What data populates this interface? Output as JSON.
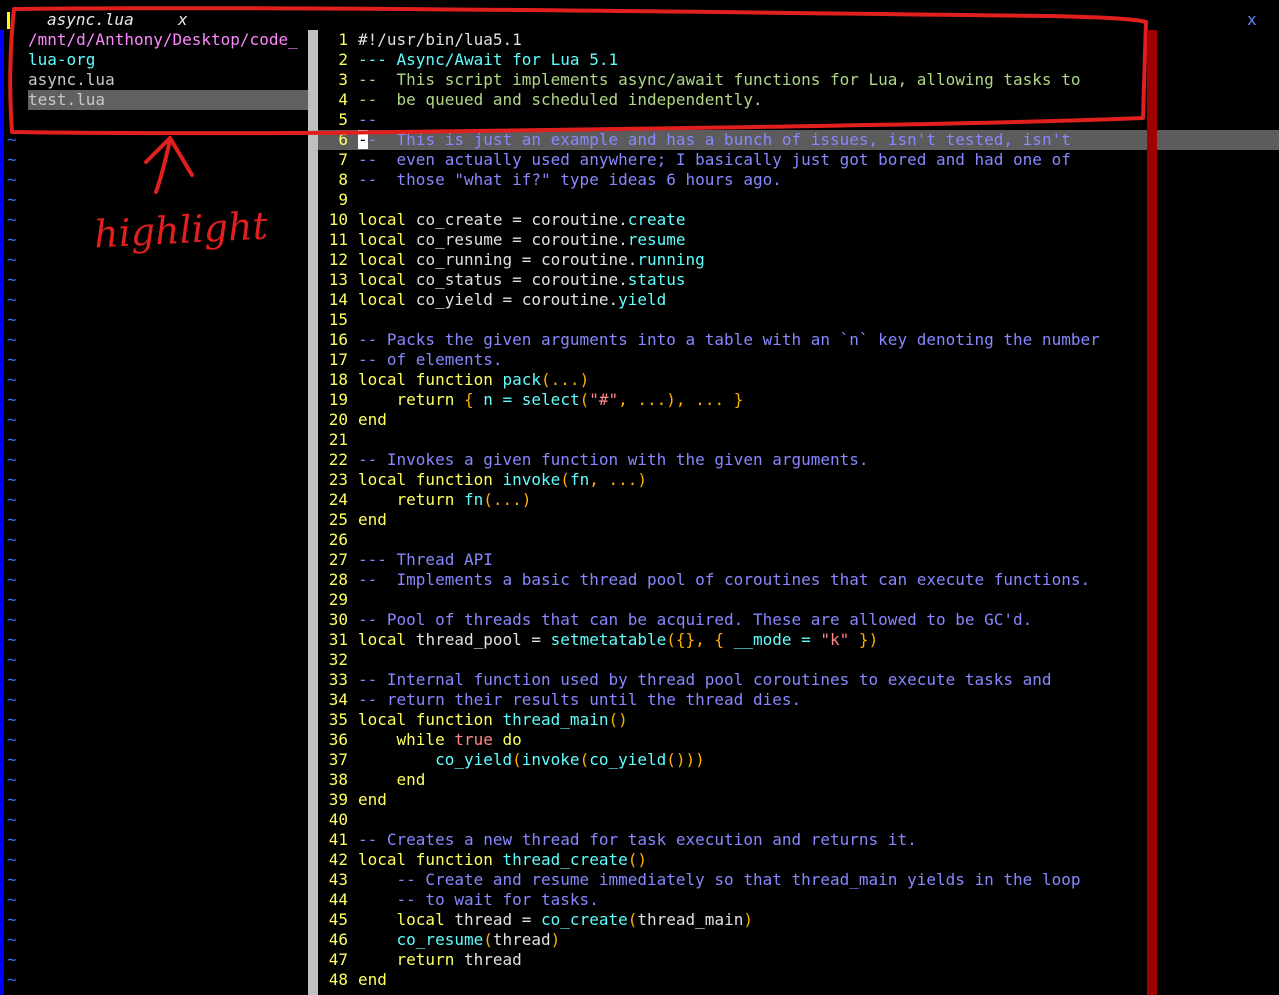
{
  "tabline": {
    "tab_title": "async.lua",
    "tab_close": "x",
    "window_close": "x"
  },
  "tree": {
    "items": [
      {
        "label": "/mnt/d/Anthony/Desktop/code_",
        "kind": "dir"
      },
      {
        "label": "lua-org",
        "kind": "org"
      },
      {
        "label": "async.lua",
        "kind": "file"
      },
      {
        "label": "test.lua",
        "kind": "file",
        "selected": true
      }
    ],
    "filler": "~"
  },
  "editor": {
    "cursor_line": 6,
    "lines": [
      [
        [
          "#!/usr/bin/lua5.1",
          "id"
        ]
      ],
      [
        [
          "--- Async/Await for Lua 5.1",
          "doc"
        ]
      ],
      [
        [
          "--  This script implements async/await functions for Lua, allowing tasks to",
          "doc2"
        ]
      ],
      [
        [
          "--  be queued and scheduled independently.",
          "doc2"
        ]
      ],
      [
        [
          "--",
          "comment"
        ]
      ],
      [
        [
          "-",
          "cursor"
        ],
        [
          "-  This is just an example and has a bunch of issues, isn't tested, isn't",
          "comment"
        ]
      ],
      [
        [
          "--  even actually used anywhere; I basically just got bored and had one of",
          "comment"
        ]
      ],
      [
        [
          "--  those \"what if?\" type ideas 6 hours ago.",
          "comment"
        ]
      ],
      [],
      [
        [
          "local",
          "kw"
        ],
        [
          " co_create = coroutine.",
          "id"
        ],
        [
          "create",
          "fn"
        ]
      ],
      [
        [
          "local",
          "kw"
        ],
        [
          " co_resume = coroutine.",
          "id"
        ],
        [
          "resume",
          "fn"
        ]
      ],
      [
        [
          "local",
          "kw"
        ],
        [
          " co_running = coroutine.",
          "id"
        ],
        [
          "running",
          "fn"
        ]
      ],
      [
        [
          "local",
          "kw"
        ],
        [
          " co_status = coroutine.",
          "id"
        ],
        [
          "status",
          "fn"
        ]
      ],
      [
        [
          "local",
          "kw"
        ],
        [
          " co_yield = coroutine.",
          "id"
        ],
        [
          "yield",
          "fn"
        ]
      ],
      [],
      [
        [
          "-- Packs the given arguments into a table with an `n` key denoting the number",
          "comment"
        ]
      ],
      [
        [
          "-- of elements.",
          "comment"
        ]
      ],
      [
        [
          "local function",
          "kw"
        ],
        [
          " ",
          "id"
        ],
        [
          "pack",
          "fn"
        ],
        [
          "(...)",
          "punc"
        ]
      ],
      [
        [
          "    return",
          "kw"
        ],
        [
          " ",
          "id"
        ],
        [
          "{",
          "punc"
        ],
        [
          " n = ",
          "fn"
        ],
        [
          "select",
          "fn"
        ],
        [
          "(",
          "punc"
        ],
        [
          "\"#\"",
          "str"
        ],
        [
          ", ...), ... }",
          "punc"
        ]
      ],
      [
        [
          "end",
          "kw"
        ]
      ],
      [],
      [
        [
          "-- Invokes a given function with the given arguments.",
          "comment"
        ]
      ],
      [
        [
          "local function",
          "kw"
        ],
        [
          " ",
          "id"
        ],
        [
          "invoke",
          "fn"
        ],
        [
          "(",
          "punc"
        ],
        [
          "fn",
          "fn"
        ],
        [
          ", ...)",
          "punc"
        ]
      ],
      [
        [
          "    return",
          "kw"
        ],
        [
          " ",
          "id"
        ],
        [
          "fn",
          "fn"
        ],
        [
          "(...)",
          "punc"
        ]
      ],
      [
        [
          "end",
          "kw"
        ]
      ],
      [],
      [
        [
          "--- Thread API",
          "comment"
        ]
      ],
      [
        [
          "--  Implements a basic thread pool of coroutines that can execute functions.",
          "comment"
        ]
      ],
      [],
      [
        [
          "-- Pool of threads that can be acquired. These are allowed to be GC'd.",
          "comment"
        ]
      ],
      [
        [
          "local",
          "kw"
        ],
        [
          " thread_pool = ",
          "id"
        ],
        [
          "setmetatable",
          "fn"
        ],
        [
          "({}, {",
          "punc"
        ],
        [
          " __mode = ",
          "fn"
        ],
        [
          "\"k\"",
          "str"
        ],
        [
          " })",
          "punc"
        ]
      ],
      [],
      [
        [
          "-- Internal function used by thread pool coroutines to execute tasks and",
          "comment"
        ]
      ],
      [
        [
          "-- return their results until the thread dies.",
          "comment"
        ]
      ],
      [
        [
          "local function",
          "kw"
        ],
        [
          " ",
          "id"
        ],
        [
          "thread_main",
          "fn"
        ],
        [
          "()",
          "punc"
        ]
      ],
      [
        [
          "    while",
          "kw"
        ],
        [
          " ",
          "id"
        ],
        [
          "true",
          "str"
        ],
        [
          " do",
          "kw"
        ]
      ],
      [
        [
          "        ",
          "id"
        ],
        [
          "co_yield",
          "fn"
        ],
        [
          "(",
          "punc"
        ],
        [
          "invoke",
          "fn"
        ],
        [
          "(",
          "punc"
        ],
        [
          "co_yield",
          "fn"
        ],
        [
          "()))",
          "punc"
        ]
      ],
      [
        [
          "    end",
          "kw"
        ]
      ],
      [
        [
          "end",
          "kw"
        ]
      ],
      [],
      [
        [
          "-- Creates a new thread for task execution and returns it.",
          "comment"
        ]
      ],
      [
        [
          "local function",
          "kw"
        ],
        [
          " ",
          "id"
        ],
        [
          "thread_create",
          "fn"
        ],
        [
          "()",
          "punc"
        ]
      ],
      [
        [
          "    -- Create and resume immediately so that thread_main yields in the loop",
          "comment"
        ]
      ],
      [
        [
          "    -- to wait for tasks.",
          "comment"
        ]
      ],
      [
        [
          "    local",
          "kw"
        ],
        [
          " thread = ",
          "id"
        ],
        [
          "co_create",
          "fn"
        ],
        [
          "(",
          "punc"
        ],
        [
          "thread_main",
          "id"
        ],
        [
          ")",
          "punc"
        ]
      ],
      [
        [
          "    ",
          "id"
        ],
        [
          "co_resume",
          "fn"
        ],
        [
          "(",
          "punc"
        ],
        [
          "thread",
          "id"
        ],
        [
          ")",
          "punc"
        ]
      ],
      [
        [
          "    return",
          "kw"
        ],
        [
          " thread",
          "id"
        ]
      ],
      [
        [
          "end",
          "kw"
        ]
      ]
    ]
  },
  "annotation": {
    "label": "highlight",
    "color": "#e21f1f"
  }
}
